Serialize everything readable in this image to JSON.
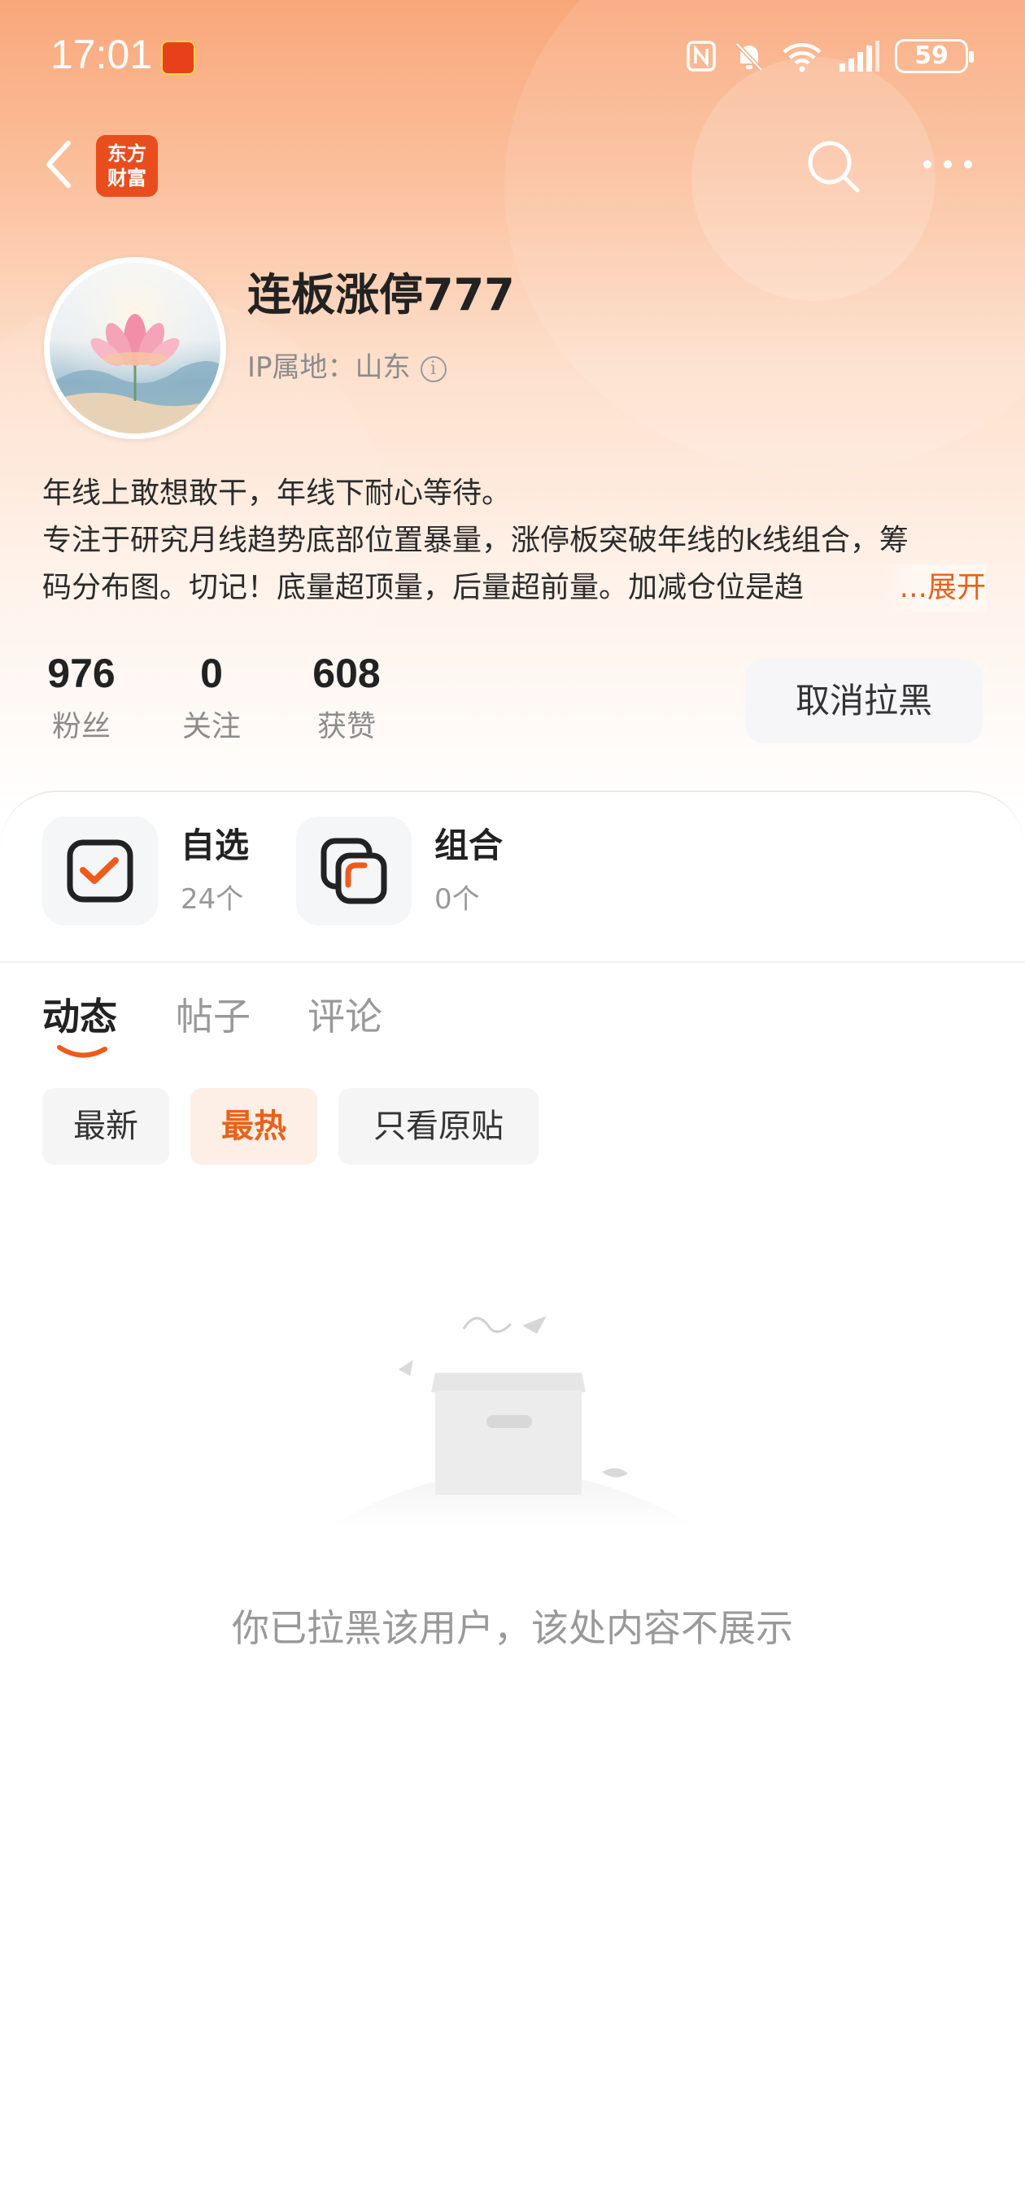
{
  "status_bar": {
    "time": "17:01",
    "battery": "59",
    "icons": [
      "nfc-icon",
      "bell-muted-icon",
      "wifi-icon",
      "signal-icon",
      "battery-icon"
    ]
  },
  "nav": {
    "logo_text": "东方财富",
    "icons": [
      "back-arrow-icon",
      "search-icon",
      "more-icon"
    ]
  },
  "profile": {
    "username": "连板涨停777",
    "ip_location": "IP属地：山东",
    "bio_line1": "年线上敢想敢干，年线下耐心等待。",
    "bio_line2": "专注于研究月线趋势底部位置暴量，涨停板突破年线的k线组合，筹",
    "bio_line3": "码分布图。切记！底量超顶量，后量超前量。加减仓位是趋",
    "expand_label": "...展开"
  },
  "stats": [
    {
      "value": "976",
      "label": "粉丝"
    },
    {
      "value": "0",
      "label": "关注"
    },
    {
      "value": "608",
      "label": "获赞"
    }
  ],
  "unblock_button": "取消拉黑",
  "shortcuts": {
    "watchlist": {
      "title": "自选",
      "count": "24个"
    },
    "portfolio": {
      "title": "组合",
      "count": "0个"
    }
  },
  "tabs": [
    "动态",
    "帖子",
    "评论"
  ],
  "active_tab": "动态",
  "filters": [
    "最新",
    "最热",
    "只看原贴"
  ],
  "active_filter": "最热",
  "empty_message": "你已拉黑该用户，该处内容不展示",
  "colors": {
    "accent": "#e8621a",
    "header_top": "#f9a77a",
    "text_primary": "#222222",
    "text_secondary": "#999999"
  }
}
